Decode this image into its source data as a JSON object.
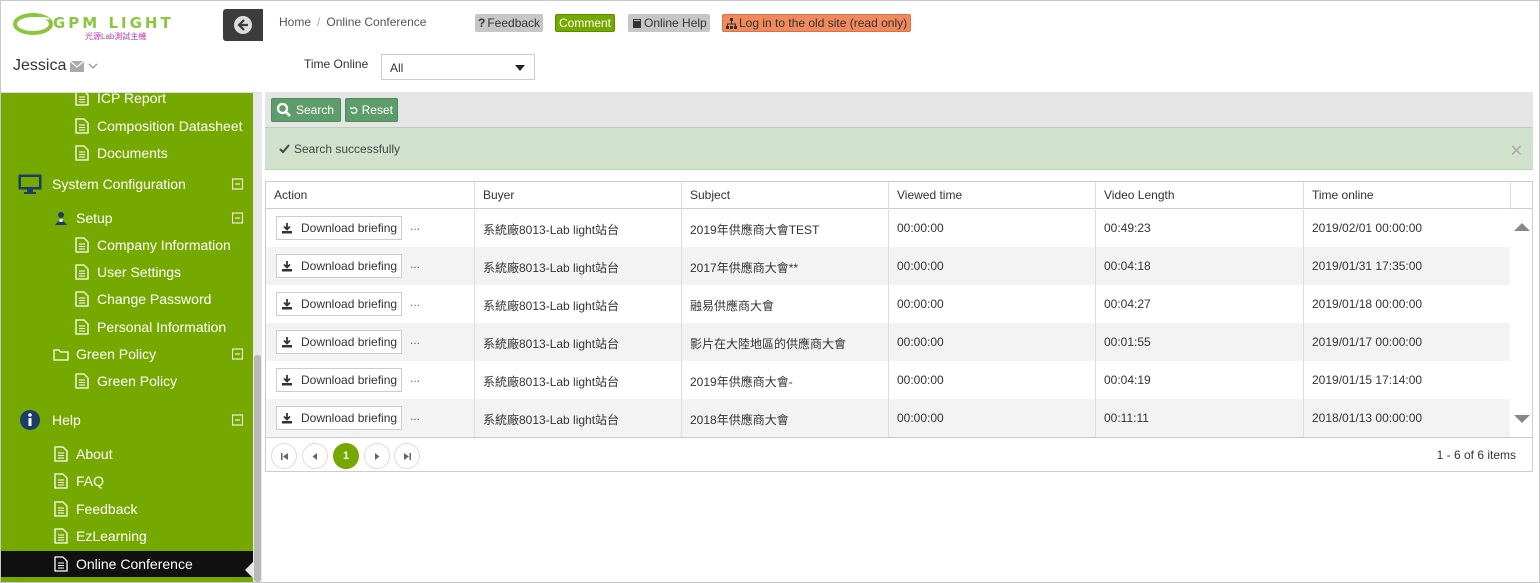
{
  "brand": {
    "logo_text": "GPM LIGHT",
    "logo_subtext": "光源Lab測試主機",
    "user_name": "Jessica"
  },
  "sidebar": {
    "items": [
      {
        "label": "ICP Report",
        "level": 2,
        "icon": "document-icon"
      },
      {
        "label": "Composition Datasheet",
        "level": 2,
        "icon": "document-icon"
      },
      {
        "label": "Documents",
        "level": 2,
        "icon": "document-icon"
      },
      {
        "label": "System Configuration",
        "level": 0,
        "icon": "monitor-icon",
        "expanded": true
      },
      {
        "label": "Setup",
        "level": 1,
        "icon": "user-group-icon",
        "expanded": true
      },
      {
        "label": "Company Information",
        "level": 2,
        "icon": "document-icon"
      },
      {
        "label": "User Settings",
        "level": 2,
        "icon": "document-icon"
      },
      {
        "label": "Change Password",
        "level": 2,
        "icon": "document-icon"
      },
      {
        "label": "Personal Information",
        "level": 2,
        "icon": "document-icon"
      },
      {
        "label": "Green Policy",
        "level": 1,
        "icon": "folder-icon",
        "expanded": true
      },
      {
        "label": "Green Policy",
        "level": 2,
        "icon": "document-icon"
      },
      {
        "label": "Help",
        "level": 0,
        "icon": "info-icon",
        "expanded": true
      },
      {
        "label": "About",
        "level": 1,
        "icon": "document-icon"
      },
      {
        "label": "FAQ",
        "level": 1,
        "icon": "document-icon"
      },
      {
        "label": "Feedback",
        "level": 1,
        "icon": "document-icon"
      },
      {
        "label": "EzLearning",
        "level": 1,
        "icon": "document-icon"
      },
      {
        "label": "Online Conference",
        "level": 1,
        "icon": "document-icon",
        "active": true
      }
    ]
  },
  "header": {
    "breadcrumb": [
      "Home",
      "Online Conference"
    ],
    "buttons": {
      "feedback": "Feedback",
      "comment": "Comment",
      "online_help": "Online Help",
      "old_site": "Log in to the old site (read only)"
    },
    "colors": {
      "feedback_bg": "#c6c6c6",
      "comment_bg": "#76a900",
      "help_bg": "#c6c6c6",
      "old_site_bg": "#f08a5d"
    }
  },
  "filter": {
    "label": "Time Online",
    "selected": "All"
  },
  "toolbar": {
    "search": "Search",
    "reset": "Reset"
  },
  "alert": {
    "message": "Search successfully"
  },
  "table": {
    "columns": [
      "Action",
      "Buyer",
      "Subject",
      "Viewed time",
      "Video Length",
      "Time online"
    ],
    "download_label": "Download briefing",
    "more_label": "...",
    "rows": [
      {
        "buyer": "系統廠8013-Lab light站台",
        "subject": "2019年供應商大會TEST",
        "viewed": "00:00:00",
        "length": "00:49:23",
        "time": "2019/02/01 00:00:00"
      },
      {
        "buyer": "系統廠8013-Lab light站台",
        "subject": "2017年供應商大會**",
        "viewed": "00:00:00",
        "length": "00:04:18",
        "time": "2019/01/31 17:35:00"
      },
      {
        "buyer": "系統廠8013-Lab light站台",
        "subject": "融易供應商大會",
        "viewed": "00:00:00",
        "length": "00:04:27",
        "time": "2019/01/18 00:00:00"
      },
      {
        "buyer": "系統廠8013-Lab light站台",
        "subject": "影片在大陸地區的供應商大會",
        "viewed": "00:00:00",
        "length": "00:01:55",
        "time": "2019/01/17 00:00:00"
      },
      {
        "buyer": "系統廠8013-Lab light站台",
        "subject": "2019年供應商大會-",
        "viewed": "00:00:00",
        "length": "00:04:19",
        "time": "2019/01/15 17:14:00"
      },
      {
        "buyer": "系統廠8013-Lab light站台",
        "subject": "2018年供應商大會",
        "viewed": "00:00:00",
        "length": "00:11:11",
        "time": "2018/01/13 00:00:00"
      }
    ]
  },
  "pager": {
    "current": "1",
    "info": "1 - 6 of 6 items"
  }
}
